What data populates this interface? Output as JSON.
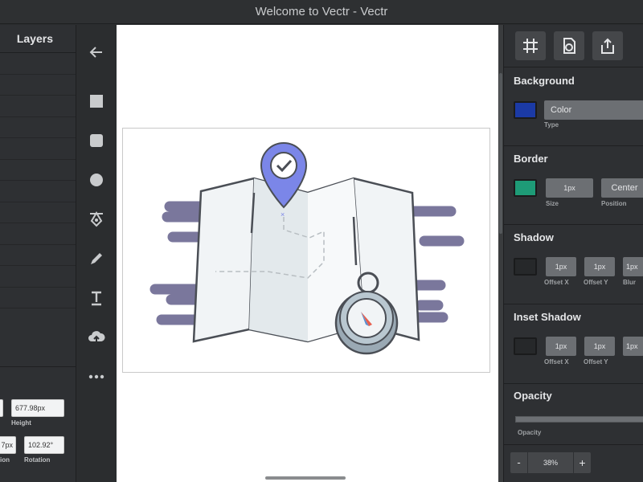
{
  "window": {
    "title": "Welcome to Vectr - Vectr"
  },
  "layers_panel": {
    "title": "Layers",
    "height_value": "677.98px",
    "height_label": "Height",
    "position_value": "7px",
    "position_label": "ion",
    "rotation_value": "102.92°",
    "rotation_label": "Rotation"
  },
  "tools": [
    "back-arrow-icon",
    "rectangle-icon",
    "rounded-rectangle-icon",
    "ellipse-icon",
    "pen-icon",
    "pencil-icon",
    "text-icon",
    "upload-icon",
    "more-icon"
  ],
  "right_panel": {
    "background": {
      "title": "Background",
      "color": "#1b3aa5",
      "type_value": "Color",
      "type_label": "Type"
    },
    "border": {
      "title": "Border",
      "color": "#1e9b77",
      "size_value": "1px",
      "size_label": "Size",
      "position_value": "Center",
      "position_label": "Position"
    },
    "shadow": {
      "title": "Shadow",
      "offset_x_value": "1px",
      "offset_x_label": "Offset X",
      "offset_y_value": "1px",
      "offset_y_label": "Offset Y",
      "blur_value": "1px",
      "blur_label": "Blur"
    },
    "inset_shadow": {
      "title": "Inset Shadow",
      "offset_x_value": "1px",
      "offset_x_label": "Offset X",
      "offset_y_value": "1px",
      "offset_y_label": "Offset Y",
      "blur_value": "1px"
    },
    "opacity": {
      "title": "Opacity",
      "label": "Opacity",
      "value": 1.0
    },
    "zoom": {
      "minus": "-",
      "value": "38%",
      "plus": "+"
    }
  },
  "colors": {
    "accent_purple": "#7b86e8",
    "map_outline": "#4a4e55",
    "speed_lines": "#7a779c"
  }
}
